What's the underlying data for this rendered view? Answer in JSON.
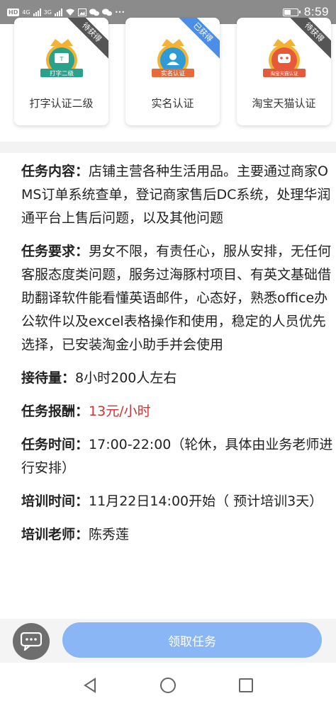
{
  "status_bar": {
    "carrier_chip": "HD",
    "network_1": "4G",
    "network_2": "3G",
    "time": "8:59",
    "battery_level": 0.5
  },
  "badges": [
    {
      "ribbon": "待获得",
      "status": "pending",
      "icon_text": "打字二级",
      "name": "打字认证二级",
      "color": "#2aa18a"
    },
    {
      "ribbon": "已获得",
      "status": "earned",
      "icon_text": "实名认证",
      "name": "实名认证",
      "color": "#2e9bd6"
    },
    {
      "ribbon": "待获得",
      "status": "pending",
      "icon_text": "淘宝天猫认证",
      "name": "淘宝天猫认证",
      "color": "#e65a3c"
    }
  ],
  "task": {
    "content": {
      "label": "任务内容：",
      "value": "店铺主营各种生活用品。主要通过商家OMS订单系统查单，登记商家售后DC系统，处理华润通平台上售后问题，以及其他问题"
    },
    "requirement": {
      "label": "任务要求：",
      "value": "男女不限，有责任心，服从安排，无任何客服态度类问题，服务过海豚村项目、有英文基础借助翻译软件能看懂英语邮件，心态好，熟悉office办公软件以及excel表格操作和使用，稳定的人员优先选择，已安装淘金小助手并会使用"
    },
    "volume": {
      "label": "接待量：",
      "value": "8小时200人左右"
    },
    "reward": {
      "label": "任务报酬：",
      "value": "13元/小时"
    },
    "time": {
      "label": "任务时间：",
      "value": "17:00-22:00（轮休，具体由业务老师进行安排）"
    },
    "training_time": {
      "label": "培训时间：",
      "value": "11月22日14:00开始（ 预计培训3天）"
    },
    "trainer": {
      "label": "培训老师：",
      "value": "陈秀莲"
    }
  },
  "actions": {
    "claim_label": "领取任务"
  },
  "icons": {
    "chat": "chat-bubble-icon",
    "back": "back-triangle-icon",
    "home": "home-circle-icon",
    "recents": "recents-square-icon"
  }
}
